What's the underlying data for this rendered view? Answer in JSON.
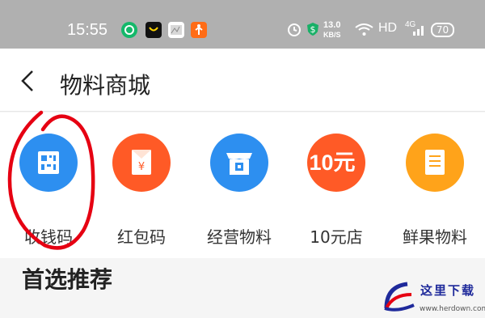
{
  "status_bar": {
    "time": "15:55",
    "network_speed_value": "13.0",
    "network_speed_unit": "KB/S",
    "hd_label": "HD",
    "signal_label": "4G",
    "battery_level": "70",
    "icons": [
      "green-circle-app-icon",
      "shopping-bag-app-icon",
      "map-app-icon",
      "fitness-app-icon",
      "alarm-icon",
      "shield-icon",
      "wifi-icon",
      "signal-icon",
      "battery-icon"
    ]
  },
  "header": {
    "back_icon": "chevron-left-icon",
    "title": "物料商城"
  },
  "menu": {
    "items": [
      {
        "label": "收钱码",
        "icon": "qr-code-icon",
        "color": "#2d8ff0"
      },
      {
        "label": "红包码",
        "icon": "red-envelope-icon",
        "color": "#ff5a26"
      },
      {
        "label": "经营物料",
        "icon": "store-qr-icon",
        "color": "#2d8ff0"
      },
      {
        "label": "10元店",
        "icon": "ten-yuan-icon",
        "color": "#ff5a26",
        "badge": "10元"
      },
      {
        "label": "鲜果物料",
        "icon": "receipt-icon",
        "color": "#ffa31a"
      }
    ]
  },
  "section": {
    "title": "首选推荐"
  },
  "watermark": {
    "text": "这里下载",
    "url": "www.herdown.com"
  },
  "colors": {
    "status_bar": "#b0b0b0",
    "blue": "#2d8ff0",
    "orange": "#ff5a26",
    "yellow": "#ffa31a",
    "annotation": "#e60012"
  }
}
